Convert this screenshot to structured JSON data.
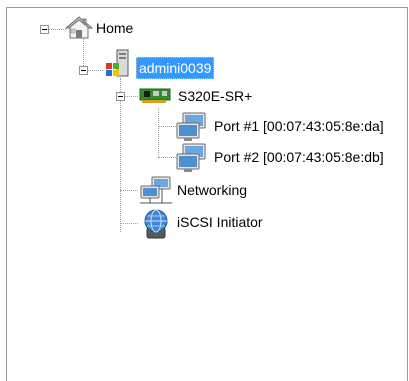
{
  "tree": {
    "home": {
      "label": "Home",
      "icon": "home-icon"
    },
    "host": {
      "label": "admini0039",
      "icon": "windows-server-icon",
      "selected": true
    },
    "adapter": {
      "label": "S320E-SR+",
      "icon": "network-card-icon"
    },
    "port1": {
      "label": "Port  #1 [00:07:43:05:8e:da]",
      "icon": "network-port-icon"
    },
    "port2": {
      "label": "Port  #2 [00:07:43:05:8e:db]",
      "icon": "network-port-icon"
    },
    "networking": {
      "label": "Networking",
      "icon": "networking-icon"
    },
    "iscsi": {
      "label": "iSCSI Initiator",
      "icon": "iscsi-globe-icon"
    }
  },
  "colors": {
    "selection": "#3399ff",
    "connector": "#a0a0a0"
  }
}
